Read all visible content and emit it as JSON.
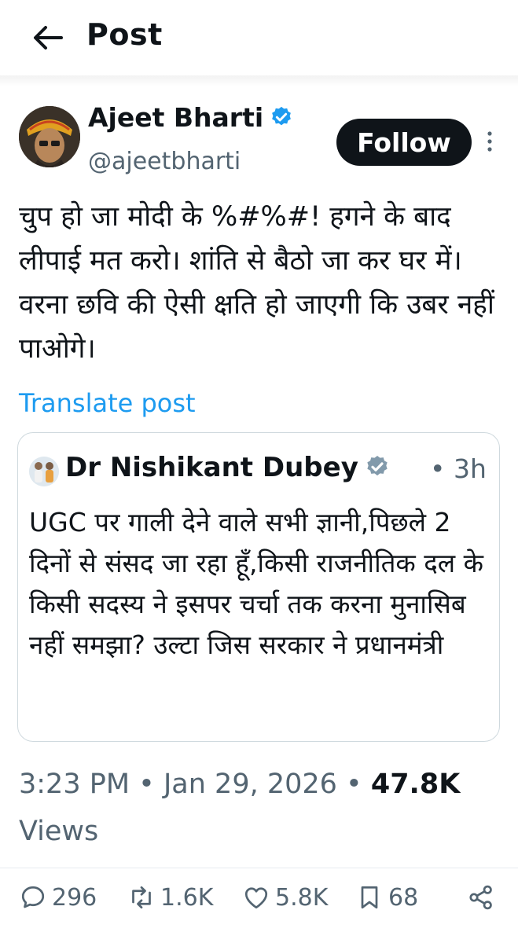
{
  "header": {
    "title": "Post",
    "back_icon": "arrow-left-icon"
  },
  "author": {
    "name": "Ajeet Bharti",
    "handle": "@ajeetbharti",
    "follow_label": "Follow",
    "verified_color": "#1d9bf0"
  },
  "post": {
    "text": "चुप हो जा मोदी के %#%#! हगने के बाद लीपाई मत करो। शांति से बैठो जा कर घर में। वरना छवि की ऐसी क्षति हो जाएगी कि उबर नहीं पाओगे।",
    "translate_label": "Translate post"
  },
  "quoted": {
    "name": "Dr Nishikant Dubey",
    "time": "• 3h",
    "verified_color": "#829aab",
    "text": "UGC पर गाली देने वाले सभी ज्ञानी,पिछले 2 दिनों से संसद जा रहा हूँ,किसी राजनीतिक दल के किसी सदस्य ने इसपर चर्चा तक करना मुनासिब नहीं समझा? उल्टा जिस सरकार ने प्रधानमंत्री"
  },
  "meta": {
    "time": "3:23 PM",
    "separator": "•",
    "date": "Jan 29, 2026",
    "views_count": "47.8K",
    "views_label": "Views"
  },
  "actions": {
    "replies": "296",
    "reposts": "1.6K",
    "likes": "5.8K",
    "bookmarks": "68"
  },
  "colors": {
    "accent": "#1d9bf0",
    "text": "#0f1419",
    "muted": "#536471",
    "border": "#cfd9de"
  }
}
